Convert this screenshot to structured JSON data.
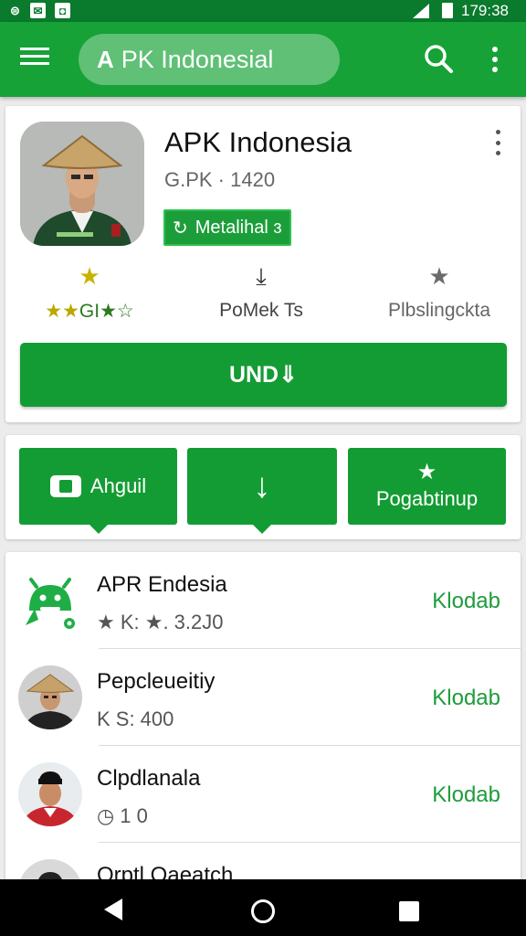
{
  "status_bar": {
    "time": "179:38",
    "icons": [
      "sync-icon",
      "message-icon",
      "android-icon",
      "signal-icon",
      "battery-icon"
    ]
  },
  "app_bar": {
    "search_text": "PK Indonesial",
    "search_icon_letter": "A"
  },
  "app": {
    "title": "APK Indonesia",
    "subtitle": "G.PK · 1420",
    "badge": "Metalihal ɜ",
    "rating_label": "GI",
    "downloads_label": "PoMek Ts",
    "category_label": "Plbslingckta",
    "install_label": "UND"
  },
  "actions": [
    {
      "label": "Ahguil",
      "icon": "screen-icon"
    },
    {
      "label": "",
      "icon": "download-icon"
    },
    {
      "label": "Pogabtinup",
      "icon": "star-icon"
    }
  ],
  "list": [
    {
      "name": "APR Endesia",
      "meta": "★ K: ★. 3.2J0",
      "action": "Klodab",
      "thumb": "android-logo"
    },
    {
      "name": "Pepcleueitiy",
      "meta": "K S: 400",
      "action": "Klodab",
      "thumb": "man-with-hat"
    },
    {
      "name": "Clpdlanala",
      "meta": "◷ 1     0",
      "action": "Klodab",
      "thumb": "man-in-red"
    },
    {
      "name": "Orptl Oaeatch",
      "meta": "",
      "action": "",
      "thumb": "person"
    }
  ],
  "colors": {
    "primary": "#16a236",
    "status_bar": "#0a7a2c",
    "button": "#139c33"
  }
}
